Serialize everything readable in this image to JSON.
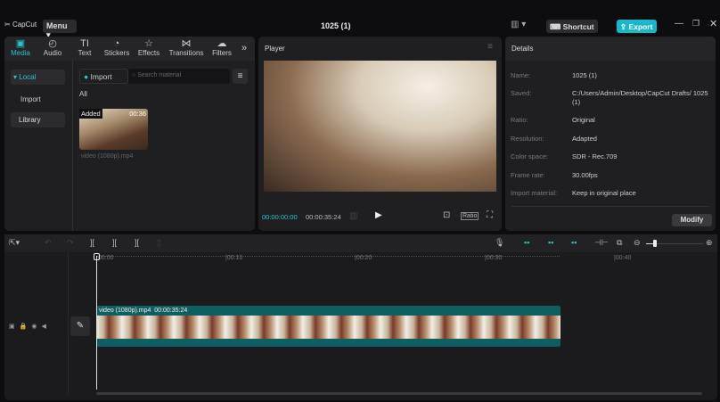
{
  "app": {
    "logo": "CapCut",
    "menu": "Menu",
    "title": "1025 (1)",
    "shortcut": "Shortcut",
    "export": "Export"
  },
  "colors": {
    "accent": "#2cc2cf",
    "clip": "#0f5f62"
  },
  "media_tabs": [
    {
      "label": "Media",
      "icon": "media-icon"
    },
    {
      "label": "Audio",
      "icon": "audio-icon"
    },
    {
      "label": "Text",
      "icon": "text-icon"
    },
    {
      "label": "Stickers",
      "icon": "sticker-icon"
    },
    {
      "label": "Effects",
      "icon": "effects-icon"
    },
    {
      "label": "Transitions",
      "icon": "transitions-icon"
    },
    {
      "label": "Filters",
      "icon": "filters-icon"
    }
  ],
  "media_sidebar": {
    "local": "Local",
    "import": "Import",
    "library": "Library"
  },
  "media": {
    "import_button": "Import",
    "search_placeholder": "Search material",
    "all": "All",
    "item": {
      "badge": "Added",
      "duration": "00:36",
      "name": "video (1080p).mp4"
    }
  },
  "player": {
    "title": "Player",
    "current_time": "00:00:00:00",
    "total_time": "00:00:35:24",
    "ratio": "Ratio"
  },
  "details": {
    "title": "Details",
    "rows": [
      {
        "k": "Name:",
        "v": "1025 (1)"
      },
      {
        "k": "Saved:",
        "v": "C:/Users/Admin/Desktop/CapCut Drafts/ 1025 (1)"
      },
      {
        "k": "Ratio:",
        "v": "Original"
      },
      {
        "k": "Resolution:",
        "v": "Adapted"
      },
      {
        "k": "Color space:",
        "v": "SDR - Rec.709"
      },
      {
        "k": "Frame rate:",
        "v": "30.00fps"
      },
      {
        "k": "Import material:",
        "v": "Keep in original place"
      }
    ],
    "modify": "Modify"
  },
  "timeline": {
    "ticks": [
      "00:00",
      "|00:10",
      "|00:20",
      "|00:30",
      "|00:40"
    ],
    "clip_name": "video (1080p).mp4",
    "clip_duration": "00:00:35:24",
    "zoom_level": 0.1
  }
}
